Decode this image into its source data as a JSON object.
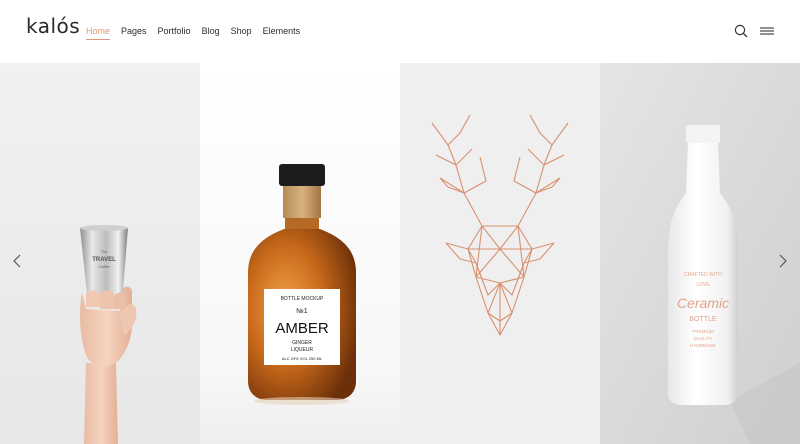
{
  "brand": {
    "name": "kalós"
  },
  "nav": {
    "items": [
      {
        "label": "Home",
        "active": true
      },
      {
        "label": "Pages",
        "active": false
      },
      {
        "label": "Portfolio",
        "active": false
      },
      {
        "label": "Blog",
        "active": false
      },
      {
        "label": "Shop",
        "active": false
      },
      {
        "label": "Elements",
        "active": false
      }
    ]
  },
  "header_icons": [
    "search-icon",
    "menu-icon"
  ],
  "colors": {
    "accent": "#d89a7b",
    "text": "#2d2d2d"
  },
  "slides": {
    "tumbler": {
      "lines": [
        "The",
        "TRAVEL",
        "Coffee"
      ]
    },
    "amber": {
      "top": "BOTTLE MOCKUP",
      "no": "№1",
      "title": "AMBER",
      "sub1": "GINGER",
      "sub2": "LIQUEUR",
      "foot": "ALC 29% VOL 250 ML"
    },
    "ceramic": {
      "top": "CRAFTED WITH",
      "love": "LOVE",
      "script": "Ceramic",
      "bottle": "BOTTLE",
      "b1": "PREMIUM",
      "b2": "QUALITY",
      "b3": "HANDMADE"
    }
  }
}
